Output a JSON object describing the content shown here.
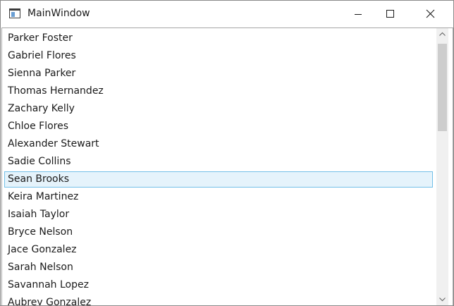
{
  "window": {
    "title": "MainWindow",
    "app_icon": "window-app-icon",
    "controls": {
      "minimize_icon": "minimize-icon",
      "maximize_icon": "maximize-icon",
      "close_icon": "close-icon"
    }
  },
  "list": {
    "items": [
      {
        "label": "Parker Foster"
      },
      {
        "label": "Gabriel Flores"
      },
      {
        "label": "Sienna Parker"
      },
      {
        "label": "Thomas Hernandez"
      },
      {
        "label": "Zachary Kelly"
      },
      {
        "label": "Chloe Flores"
      },
      {
        "label": "Alexander Stewart"
      },
      {
        "label": "Sadie Collins"
      },
      {
        "label": "Sean Brooks"
      },
      {
        "label": "Keira Martinez"
      },
      {
        "label": "Isaiah Taylor"
      },
      {
        "label": "Bryce Nelson"
      },
      {
        "label": "Jace Gonzalez"
      },
      {
        "label": "Sarah Nelson"
      },
      {
        "label": "Savannah Lopez"
      },
      {
        "label": "Aubrey Gonzalez"
      }
    ],
    "selected_index": 8,
    "scroll_position": 0
  },
  "colors": {
    "selection_fill": "#e5f3fb",
    "selection_border": "#73c0e8",
    "scroll_thumb": "#cdcdcd",
    "scroll_track": "#f0f0f0"
  }
}
